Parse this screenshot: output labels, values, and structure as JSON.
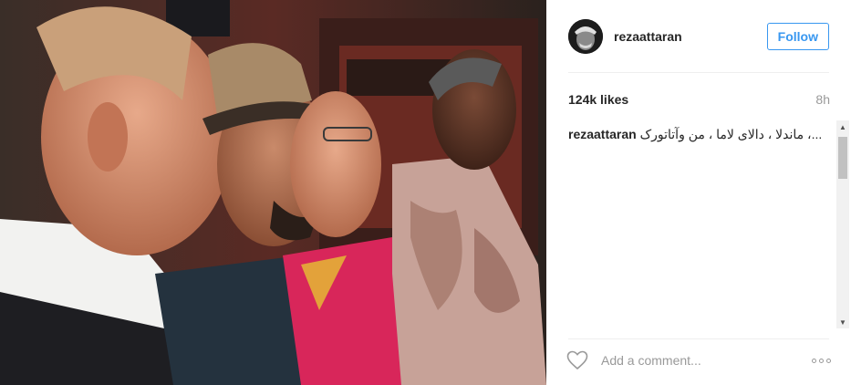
{
  "post": {
    "username": "rezaattaran",
    "follow_label": "Follow",
    "likes": "124k likes",
    "time": "8h",
    "caption_user": "rezaattaran",
    "caption_text": "...، ماندلا ، دالای لاما ، من وآتاتورک",
    "comment_placeholder": "Add a comment..."
  },
  "colors": {
    "accent": "#3897f0",
    "text": "#262626",
    "muted": "#999999",
    "divider": "#efefef"
  },
  "icons": {
    "like": "heart-icon",
    "more": "more-options-icon",
    "avatar": "avatar"
  }
}
